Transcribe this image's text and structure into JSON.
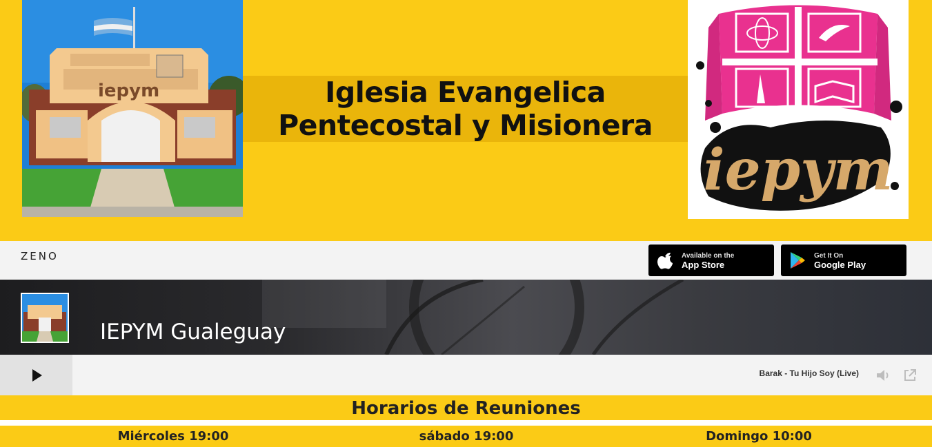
{
  "header": {
    "title_line1": "Iglesia Evangelica",
    "title_line2": "Pentecostal y Misionera",
    "photo_sign": "iepym",
    "logo_text": "iepym"
  },
  "zeno": {
    "brand": "ZENO",
    "appstore_small": "Available on the",
    "appstore_big": "App Store",
    "googleplay_small": "Get It On",
    "googleplay_big": "Google Play"
  },
  "player": {
    "station_name": "IEPYM Gualeguay",
    "now_playing": "Barak - Tu Hijo Soy (Live)"
  },
  "schedule": {
    "title": "Horarios de Reuniones",
    "slots": [
      "Miércoles 19:00",
      "sábado 19:00",
      "Domingo 10:00"
    ]
  },
  "colors": {
    "background": "#fbcb16",
    "title_band": "#eab50b",
    "logo_pink": "#e9318f"
  }
}
